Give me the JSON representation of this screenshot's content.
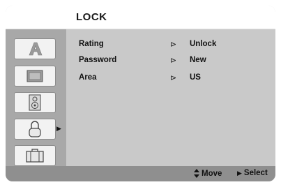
{
  "menu": {
    "title": "LOCK"
  },
  "sidebar": {
    "items": [
      {
        "name": "language",
        "icon": "language-a-icon",
        "selected": false
      },
      {
        "name": "display",
        "icon": "tv-screen-icon",
        "selected": false
      },
      {
        "name": "audio",
        "icon": "speaker-icon",
        "selected": false
      },
      {
        "name": "lock",
        "icon": "padlock-icon",
        "selected": true
      },
      {
        "name": "others",
        "icon": "briefcase-icon",
        "selected": false
      }
    ],
    "selected_arrow": "▶"
  },
  "rows": [
    {
      "label": "Rating",
      "arrow": "⊳",
      "value": "Unlock"
    },
    {
      "label": "Password",
      "arrow": "⊳",
      "value": "New"
    },
    {
      "label": "Area",
      "arrow": "⊳",
      "value": "US"
    }
  ],
  "status": {
    "move_icon": "▲▼",
    "move_label": "Move",
    "select_icon": "▶",
    "select_label": "Select"
  },
  "colors": {
    "background": "#cfcfcf",
    "sidebar": "#a8a8a8",
    "status_bar": "#8f8f8f",
    "title_bar": "#ffffff"
  }
}
